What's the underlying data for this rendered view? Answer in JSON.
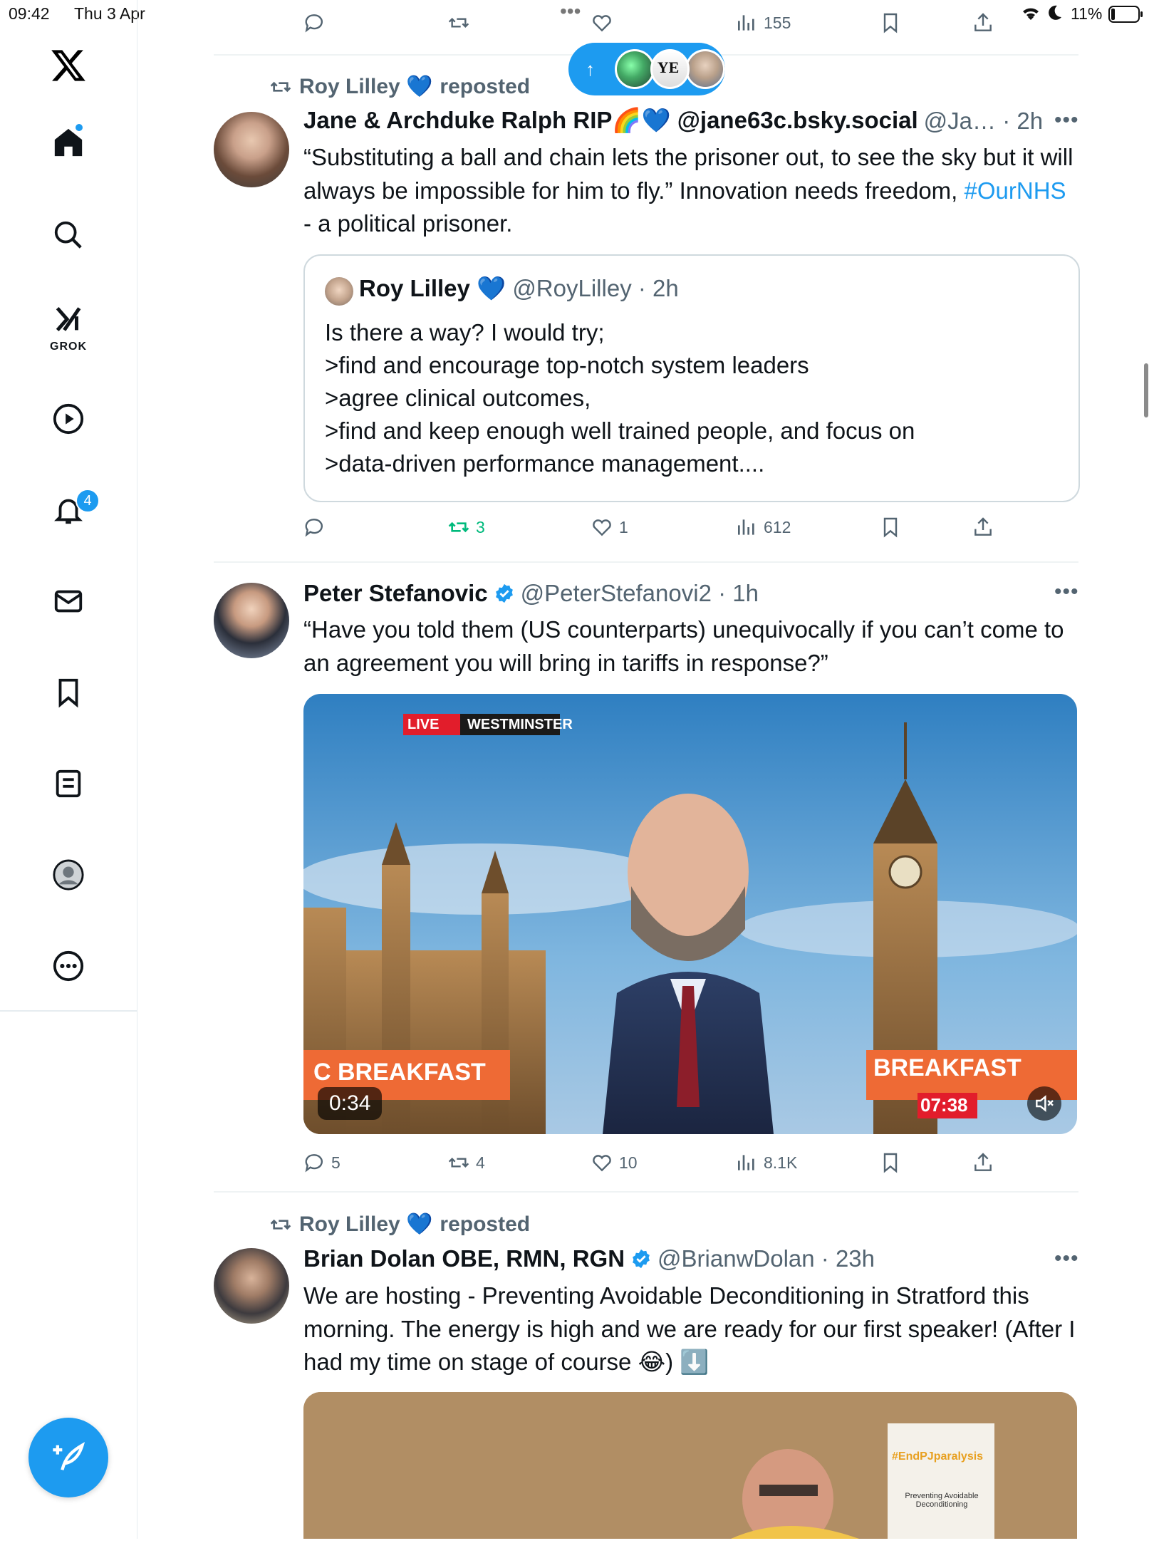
{
  "status_bar": {
    "time": "09:42",
    "date": "Thu 3 Apr",
    "dots": "•••",
    "battery": "11%"
  },
  "sidebar": {
    "notif_count": "4",
    "grok_label": "GROK",
    "items": [
      "home-icon",
      "search-icon",
      "grok-icon",
      "video-icon",
      "notifications-icon",
      "messages-icon",
      "bookmarks-icon",
      "lists-icon",
      "profile-icon",
      "more-icon"
    ]
  },
  "top_actions": {
    "views": "155"
  },
  "new_posts_pill": {
    "arrow": "↑"
  },
  "posts": [
    {
      "repost_by": "Roy Lilley 💙",
      "repost_suffix": "reposted",
      "name": "Jane & Archduke Ralph RIP🌈💙 @jane63c.bsky.social",
      "handle_time": "@Ja… · 2h",
      "text_1": "“Substituting a ball and chain lets the prisoner out, to see the sky but it will always be impossible for him to fly.” Innovation needs freedom,",
      "hashtag": "#OurNHS",
      "text_2": " - a political prisoner.",
      "quote": {
        "name": "Roy Lilley 💙",
        "handle_time": "@RoyLilley · 2h",
        "lines": [
          "Is there a way? I would try;",
          ">find and encourage top-notch system leaders",
          ">agree clinical outcomes,",
          ">find and keep enough well trained people, and focus on",
          ">data-driven performance management...."
        ]
      },
      "reposts": "3",
      "likes": "1",
      "views": "612"
    },
    {
      "name": "Peter Stefanovic",
      "handle_time": "@PeterStefanovi2 · 1h",
      "text": "“Have you told them (US counterparts) unequivocally if you can’t come to an agreement you will bring in tariffs in response?”",
      "video": {
        "live_tag": "LIVE",
        "location_tag": "WESTMINSTER",
        "banner_left": "C BREAKFAST",
        "banner_right": "BREAKFAST",
        "clock": "07:38",
        "duration": "0:34"
      },
      "replies": "5",
      "reposts": "4",
      "likes": "10",
      "views": "8.1K"
    },
    {
      "repost_by": "Roy Lilley 💙",
      "repost_suffix": "reposted",
      "name": "Brian Dolan OBE, RMN, RGN",
      "handle_time": "@BrianwDolan · 23h",
      "text": "We are hosting - Preventing Avoidable Deconditioning in Stratford this morning. The energy is high and we are ready for our first speaker! (After I had my time on stage of course 😂) ⬇️",
      "banner_text": "#EndPJparalysis",
      "banner_sub": "Preventing Avoidable Deconditioning"
    }
  ],
  "colors": {
    "accent": "#1d9bf0",
    "repost_green": "#00ba7c",
    "muted": "#536471"
  }
}
